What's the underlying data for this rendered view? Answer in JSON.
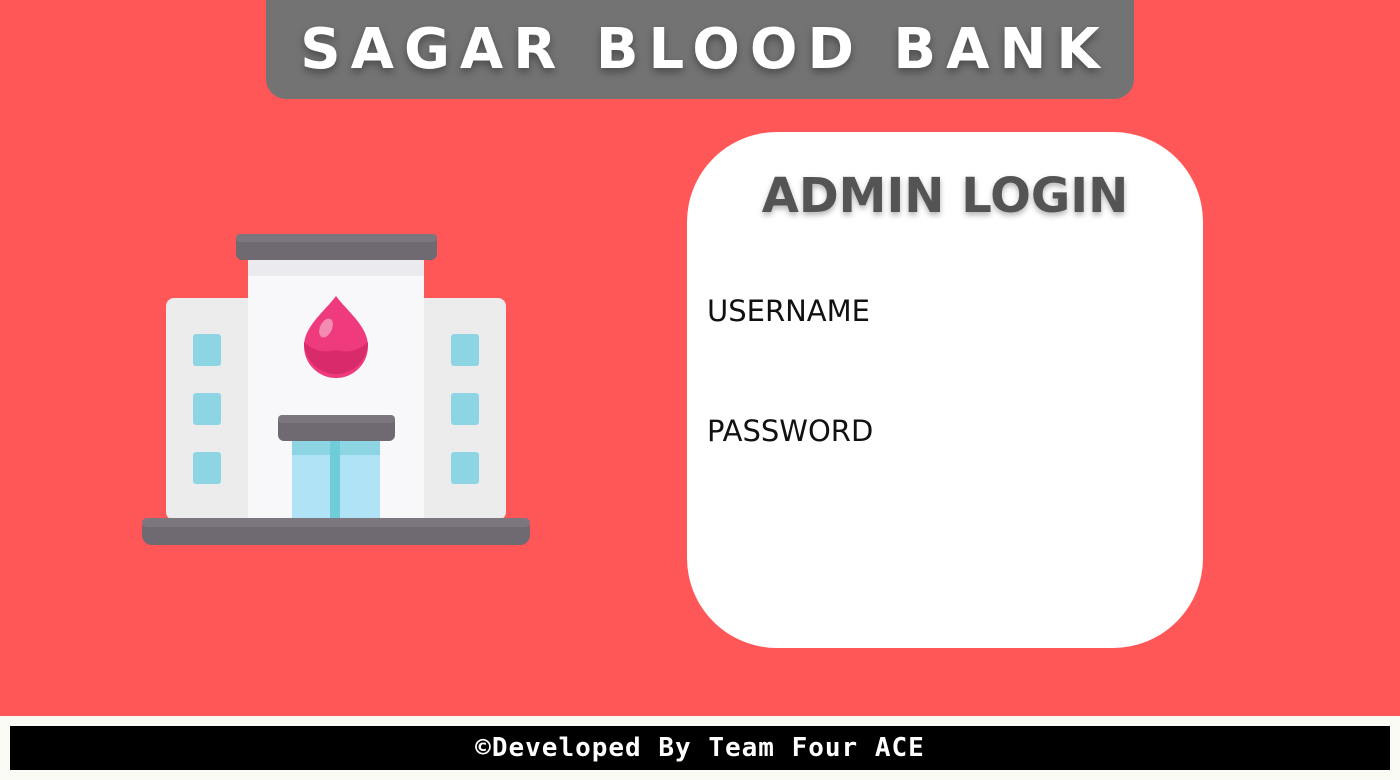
{
  "header": {
    "title": "SAGAR BLOOD BANK"
  },
  "illustration": {
    "icon": "blood-bank-building-icon"
  },
  "login": {
    "heading": "ADMIN LOGIN",
    "username_label": "USERNAME",
    "password_label": "PASSWORD",
    "username_value": "",
    "password_value": ""
  },
  "footer": {
    "text": "©Developed By Team Four ACE"
  },
  "colors": {
    "background": "#ff5757",
    "title_bar": "#737373",
    "card": "#ffffff",
    "footer_bar": "#000000",
    "blood_drop": "#ef3a7d"
  }
}
